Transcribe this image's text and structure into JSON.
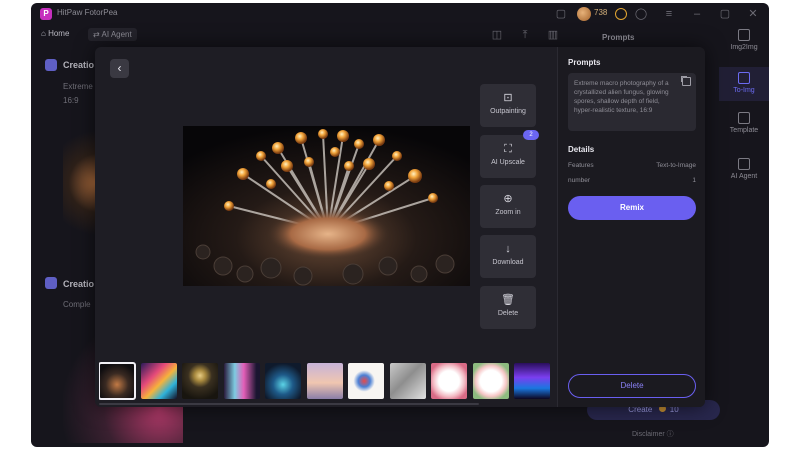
{
  "app": {
    "title": "HitPaw FotorPea",
    "credits": "738"
  },
  "nav": {
    "home": "Home",
    "ai_agent": "AI Agent"
  },
  "background": {
    "card1_title": "Creatio",
    "card1_line1": "Extreme",
    "card1_line2": "16:9",
    "card2_title": "Creatio",
    "card2_line1": "Comple",
    "prompts_header": "Prompts",
    "rail": [
      {
        "label": "Img2Img",
        "active": false
      },
      {
        "label": "To-Img",
        "active": true
      },
      {
        "label": "Template",
        "active": false
      },
      {
        "label": "AI Agent",
        "active": false
      }
    ],
    "create_label": "Create",
    "create_cost": "10",
    "disclaimer": "Disclaimer"
  },
  "modal": {
    "tools": [
      {
        "label": "Outpainting",
        "icon": "outpainting-icon",
        "glyph": "⊡"
      },
      {
        "label": "AI Upscale",
        "icon": "upscale-icon",
        "glyph": "⛶",
        "badge": "2"
      },
      {
        "label": "Zoom in",
        "icon": "zoom-in-icon",
        "glyph": "⊕"
      },
      {
        "label": "Download",
        "icon": "download-icon",
        "glyph": "↓"
      },
      {
        "label": "Delete",
        "icon": "trash-icon",
        "glyph": "🗑"
      }
    ],
    "thumbnails": [
      {
        "name": "fungus-macro",
        "selected": true,
        "bg": "radial-gradient(circle at 50% 60%, #c27a45 0%, #3a2a22 40%, #0f0d10 75%)"
      },
      {
        "name": "color-swirl",
        "selected": false,
        "bg": "linear-gradient(135deg, #2b1a5a, #e54a7a 35%, #f6b23b 55%, #2fb1d9 75%, #141025)"
      },
      {
        "name": "moon-landscape",
        "selected": false,
        "bg": "radial-gradient(circle at 50% 35%, #e7cc84 0%, #a98a3f 18%, #3a3020 40%, #18150f 80%)"
      },
      {
        "name": "glitch-portrait",
        "selected": false,
        "bg": "linear-gradient(90deg, #2a1c3d, #7ecbe1 30%, #e35fb8 55%, #1a1530 90%)"
      },
      {
        "name": "peacock-glow",
        "selected": false,
        "bg": "radial-gradient(circle at 50% 60%, #5bd3e6 0%, #1e5a89 35%, #0f1a2c 75%)"
      },
      {
        "name": "pastel-sunset",
        "selected": false,
        "bg": "linear-gradient(180deg, #c7b3d8, #f0c6b0 55%, #8a7ea8)"
      },
      {
        "name": "flower-figure",
        "selected": false,
        "bg": "radial-gradient(circle at 45% 50%, #e84a4a 0%, #4b7fd4 22%, #f7f5f2 40%)"
      },
      {
        "name": "silver-pattern",
        "selected": false,
        "bg": "linear-gradient(135deg, #c9c9c9, #8e8e8e 45%, #e2e2e2)"
      },
      {
        "name": "rose-frame",
        "selected": false,
        "bg": "radial-gradient(circle at 50% 50%, #ffffff 40%, #f2b8c2 62%, #d96b86 80%)"
      },
      {
        "name": "floral-wreath",
        "selected": false,
        "bg": "radial-gradient(circle at 50% 50%, #ffffff 42%, #f6c6c6 60%, #8dbb7f 78%)"
      },
      {
        "name": "concert-lights",
        "selected": false,
        "bg": "linear-gradient(180deg, #2a0f5c, #7b3ef0 40%, #1a77e0 70%, #0d0620)"
      }
    ],
    "panel": {
      "prompts_title": "Prompts",
      "prompt_text": "Extreme macro photography of a crystallized alien fungus, glowing spores, shallow depth of field, hyper-realistic texture, 16:9",
      "details_title": "Details",
      "features_label": "Features",
      "features_value": "Text-to-Image",
      "number_label": "number",
      "number_value": "1",
      "remix_label": "Remix",
      "delete_label": "Delete"
    }
  }
}
